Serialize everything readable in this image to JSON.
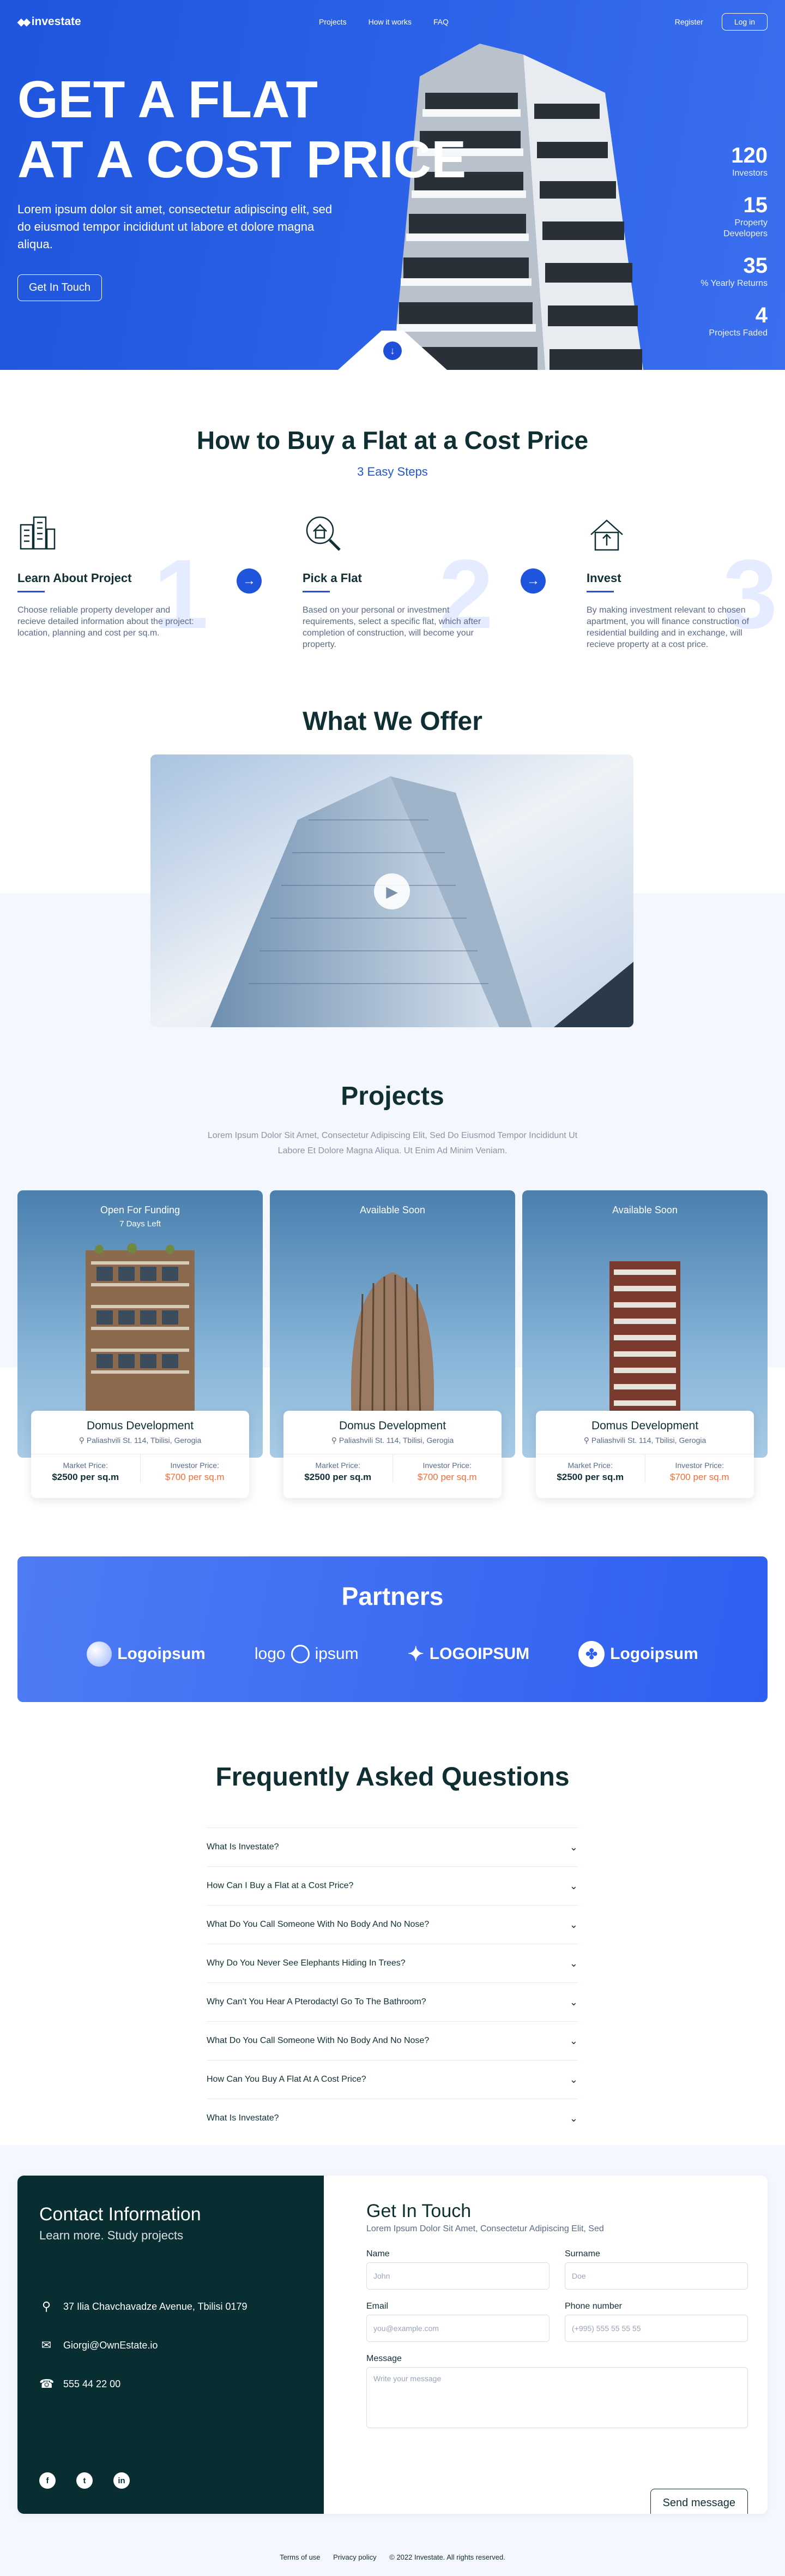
{
  "nav": {
    "logo": "investate",
    "links": [
      "Projects",
      "How it works",
      "FAQ"
    ],
    "register": "Register",
    "login": "Log in"
  },
  "hero": {
    "title_line1": "GET A FLAT",
    "title_line2": "AT A COST PRICE",
    "subtitle": "Lorem ipsum dolor sit amet, consectetur adipiscing elit, sed do eiusmod tempor incididunt ut labore et dolore magna aliqua.",
    "cta": "Get In Touch",
    "stats": [
      {
        "num": "120",
        "label": "Investors"
      },
      {
        "num": "15",
        "label": "Property Developers"
      },
      {
        "num": "35",
        "label": "% Yearly Returns"
      },
      {
        "num": "4",
        "label": "Projects Faded"
      }
    ]
  },
  "steps": {
    "title": "How to Buy a Flat at a Cost Price",
    "subtitle": "3 Easy Steps",
    "items": [
      {
        "num": "1",
        "title": "Learn About Project",
        "desc": "Choose reliable property developer and recieve detailed information about the project: location, planning and cost per sq.m.",
        "icon": "buildings-icon"
      },
      {
        "num": "2",
        "title": "Pick a Flat",
        "desc": "Based on your personal or investment requirements, select a specific flat, which after completion of construction, will become your property.",
        "icon": "house-search-icon"
      },
      {
        "num": "3",
        "title": "Invest",
        "desc": "By making investment relevant to chosen apartment, you will finance construction of residential building and in exchange, will recieve property at a cost price.",
        "icon": "house-up-icon"
      }
    ]
  },
  "offer": {
    "title": "What We Offer"
  },
  "projects": {
    "title": "Projects",
    "subtitle": "Lorem Ipsum Dolor Sit Amet, Consectetur Adipiscing Elit, Sed Do Eiusmod Tempor Incididunt Ut Labore Et Dolore Magna Aliqua. Ut Enim Ad Minim Veniam.",
    "cards": [
      {
        "status": "Open For Funding",
        "days": "7 Days Left",
        "name": "Domus Development",
        "address": "Paliashvili St. 114, Tbilisi, Gerogia",
        "market_label": "Market Price:",
        "market": "$2500 per sq.m",
        "investor_label": "Investor Price:",
        "investor": "$700 per sq.m"
      },
      {
        "status": "Available Soon",
        "days": "",
        "name": "Domus Development",
        "address": "Paliashvili St. 114, Tbilisi, Gerogia",
        "market_label": "Market Price:",
        "market": "$2500 per sq.m",
        "investor_label": "Investor Price:",
        "investor": "$700 per sq.m"
      },
      {
        "status": "Available Soon",
        "days": "",
        "name": "Domus Development",
        "address": "Paliashvili St. 114, Tbilisi, Gerogia",
        "market_label": "Market Price:",
        "market": "$2500 per sq.m",
        "investor_label": "Investor Price:",
        "investor": "$700 per sq.m"
      }
    ]
  },
  "partners": {
    "title": "Partners",
    "logos": [
      "Logoipsum",
      "logo",
      "ipsum",
      "LOGOIPSUM",
      "Logoipsum"
    ]
  },
  "faq": {
    "title": "Frequently Asked Questions",
    "items": [
      "What Is Investate?",
      "How Can I Buy a Flat at a Cost Price?",
      "What Do You Call Someone With No Body And No Nose?",
      "Why Do You Never See Elephants Hiding In Trees?",
      "Why Can't You Hear A Pterodactyl Go To The Bathroom?",
      "What Do You Call Someone With No Body And No Nose?",
      "How Can You Buy A Flat At A Cost Price?",
      "What Is Investate?"
    ]
  },
  "contact": {
    "title": "Contact Information",
    "subtitle": "Learn more. Study projects",
    "address": "37 Ilia Chavchavadze Avenue, Tbilisi 0179",
    "email": "Giorgi@OwnEstate.io",
    "phone": "555 44 22 00",
    "form": {
      "title": "Get In Touch",
      "subtitle": "Lorem Ipsum Dolor Sit Amet, Consectetur Adipiscing Elit, Sed",
      "name_label": "Name",
      "name_placeholder": "John",
      "surname_label": "Surname",
      "surname_placeholder": "Doe",
      "email_label": "Email",
      "email_placeholder": "you@example.com",
      "phone_label": "Phone number",
      "phone_placeholder": "(+995) 555 55 55 55",
      "message_label": "Message",
      "message_placeholder": "Write your message",
      "send": "Send message"
    }
  },
  "footer": {
    "terms": "Terms of use",
    "privacy": "Privacy policy",
    "copyright": "© 2022 Investate. All rights reserved."
  },
  "colors": {
    "primary": "#1f55dd",
    "dark": "#0f2f33",
    "contact_panel": "#082e32",
    "accent_orange": "#f26d3d"
  }
}
